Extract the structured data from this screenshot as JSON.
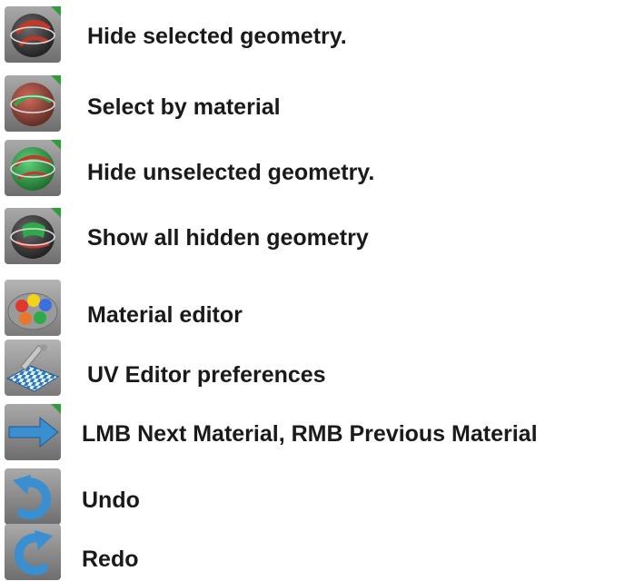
{
  "tools": [
    {
      "icon": "hide-selected-geometry-icon",
      "label": "Hide selected geometry."
    },
    {
      "icon": "select-by-material-icon",
      "label": "Select by material"
    },
    {
      "icon": "hide-unselected-geometry-icon",
      "label": "Hide unselected geometry."
    },
    {
      "icon": "show-all-hidden-geometry-icon",
      "label": "Show all hidden geometry"
    },
    {
      "icon": "material-editor-icon",
      "label": "Material editor"
    },
    {
      "icon": "uv-editor-preferences-icon",
      "label": "UV Editor preferences"
    },
    {
      "icon": "next-previous-material-icon",
      "label": "LMB Next Material, RMB Previous Material"
    },
    {
      "icon": "undo-icon",
      "label": "Undo"
    },
    {
      "icon": "redo-icon",
      "label": "Redo"
    }
  ],
  "colors": {
    "text": "#1a1a1a",
    "icon_frame": "#8a8a8a",
    "corner_marker": "#2e9e3a",
    "sphere_dark": "#3a3a3a",
    "sphere_red": "#c0392b",
    "sphere_green": "#2faa4a",
    "arrow_blue": "#3a8fd0"
  }
}
